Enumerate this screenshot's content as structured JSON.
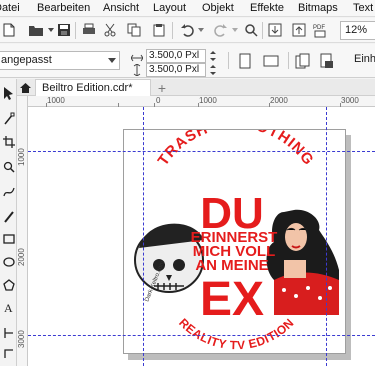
{
  "menubar": {
    "items": [
      {
        "label": "Datei"
      },
      {
        "label": "Bearbeiten"
      },
      {
        "label": "Ansicht"
      },
      {
        "label": "Layout"
      },
      {
        "label": "Objekt"
      },
      {
        "label": "Effekte"
      },
      {
        "label": "Bitmaps"
      },
      {
        "label": "Text"
      }
    ]
  },
  "toolbar": {
    "zoom_value": "12%",
    "icons": [
      "new-document-icon",
      "open-folder-icon",
      "save-icon",
      "print-icon",
      "cut-icon",
      "copy-icon",
      "paste-icon",
      "undo-icon",
      "redo-icon",
      "search-icon",
      "import-icon",
      "export-icon",
      "pdf-icon",
      "app-launcher-icon"
    ]
  },
  "property_bar": {
    "preset": "angepasst",
    "width": "3.500,0 Pxl",
    "height": "3.500,0 Pxl",
    "units_label": "Einh"
  },
  "tabs": {
    "document_tab": "Beiltro Edition.cdr*"
  },
  "ruler": {
    "h_labels": [
      "1000",
      "0",
      "1000",
      "2000",
      "3000"
    ],
    "v_labels": [
      "1000",
      "2000",
      "3000"
    ]
  },
  "artwork": {
    "arc_top": "TRASH OR NOTHING",
    "big_top": "DU",
    "line1": "ERINNERST",
    "line2": "MICH VOLL",
    "line3": "AN MEINE",
    "big_bottom": "EX",
    "arc_bottom": "REALITY TV EDITION",
    "watermark": "Dark-Keltro.com",
    "text_color": "#e51c1c",
    "skull_color": "#222222"
  },
  "colors": {
    "guide": "#3b3bd1",
    "accent_red": "#e51c1c"
  }
}
